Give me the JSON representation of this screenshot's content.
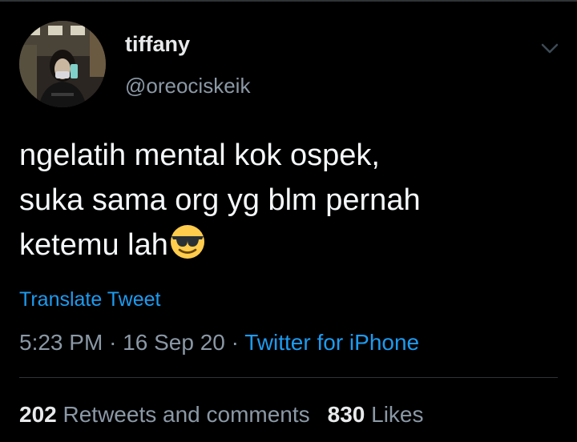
{
  "tweet": {
    "author": {
      "display_name": "tiffany",
      "handle": "@oreociskeik"
    },
    "text_lines": [
      "ngelatih mental kok ospek,",
      "suka sama org yg blm pernah",
      "ketemu lah"
    ],
    "emoji": "smiling-face-with-sunglasses",
    "translate_label": "Translate Tweet",
    "time": "5:23 PM",
    "date": "16 Sep 20",
    "separator": "·",
    "source": "Twitter for iPhone",
    "stats": {
      "retweets_count": "202",
      "retweets_label": "Retweets and comments",
      "likes_count": "830",
      "likes_label": "Likes"
    }
  },
  "icons": {
    "more": "chevron-down-icon",
    "avatar": "profile-photo"
  },
  "colors": {
    "background": "#000000",
    "primary_text": "#e7e9ea",
    "secondary_text": "#8b98a5",
    "link": "#1d9bf0",
    "divider": "#2f3336"
  }
}
